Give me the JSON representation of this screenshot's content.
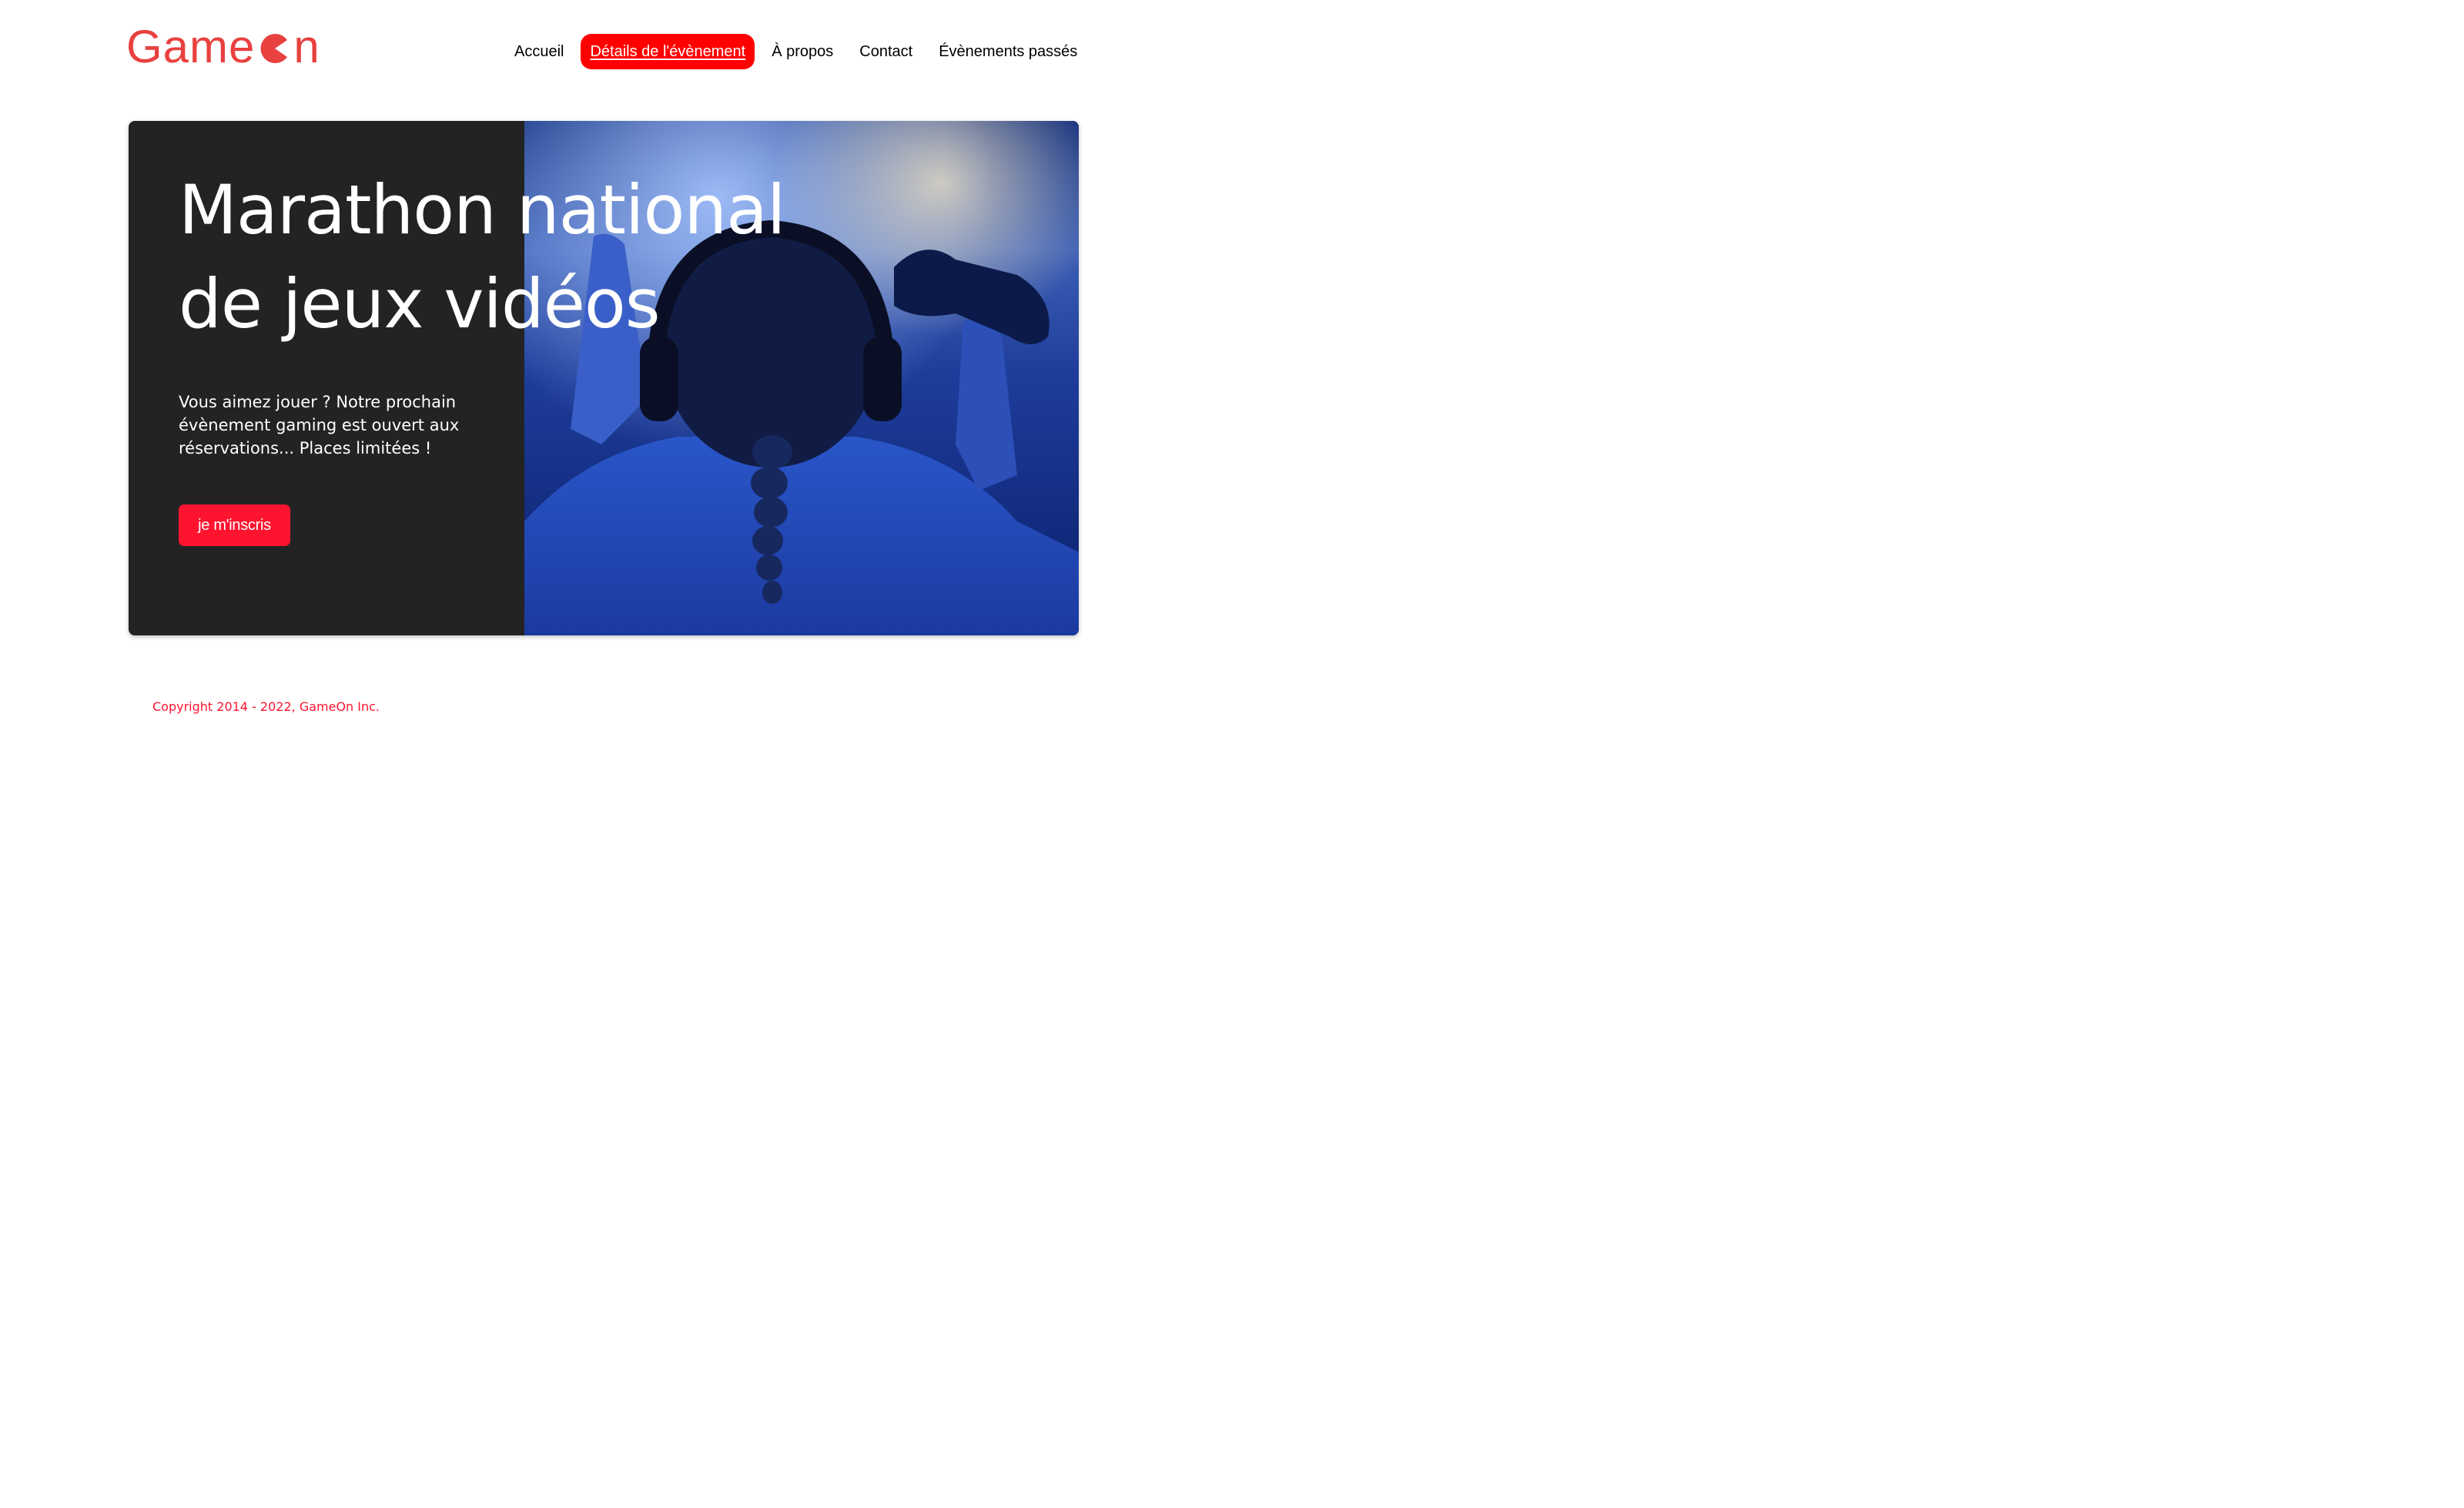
{
  "header": {
    "logo_prefix": "Game",
    "logo_suffix": "n",
    "brand_color": "#e8413f"
  },
  "nav": {
    "items": [
      {
        "label": "Accueil",
        "active": false
      },
      {
        "label": "Détails de l'évènement",
        "active": true
      },
      {
        "label": "À propos",
        "active": false
      },
      {
        "label": "Contact",
        "active": false
      },
      {
        "label": "Évènements passés",
        "active": false
      }
    ],
    "active_color": "#ff0000"
  },
  "hero": {
    "title_line1": "Marathon national",
    "title_line2": "de jeux vidéos",
    "description": "Vous aimez jouer ? Notre prochain évènement gaming est ouvert aux réservations... Places limitées !",
    "cta_label": "je m'inscris",
    "panel_color": "#232323",
    "cta_color": "#fe142f"
  },
  "footer": {
    "copyright": "Copyright 2014 - 2022, GameOn Inc."
  }
}
